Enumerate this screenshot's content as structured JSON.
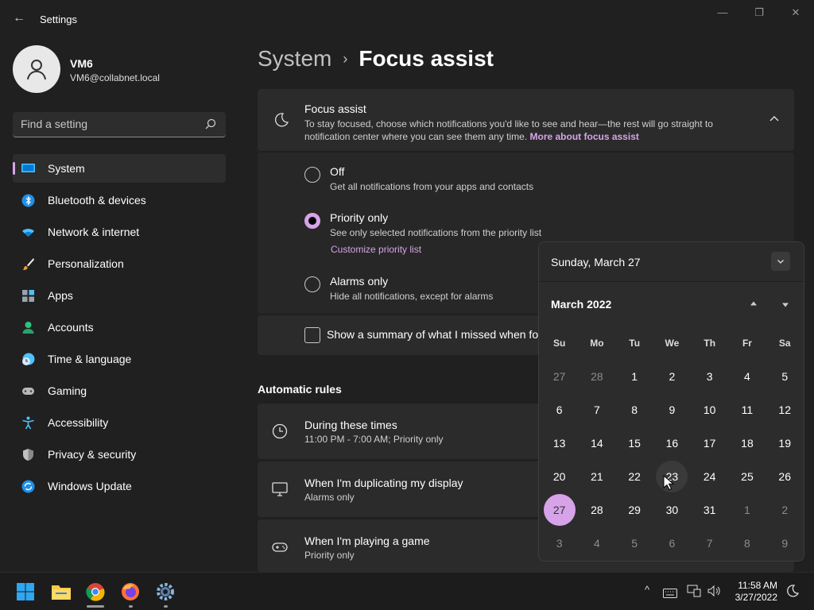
{
  "app": {
    "title": "Settings",
    "back_glyph": "←",
    "min_glyph": "—",
    "max_glyph": "❐",
    "close_glyph": "✕"
  },
  "user": {
    "name": "VM6",
    "email": "VM6@collabnet.local"
  },
  "search": {
    "placeholder": "Find a setting"
  },
  "nav": {
    "items": [
      {
        "label": "System",
        "icon": "monitor-icon",
        "active": true
      },
      {
        "label": "Bluetooth & devices",
        "icon": "bluetooth-icon"
      },
      {
        "label": "Network & internet",
        "icon": "wifi-icon"
      },
      {
        "label": "Personalization",
        "icon": "brush-icon"
      },
      {
        "label": "Apps",
        "icon": "apps-icon"
      },
      {
        "label": "Accounts",
        "icon": "person-icon"
      },
      {
        "label": "Time & language",
        "icon": "clock-globe-icon"
      },
      {
        "label": "Gaming",
        "icon": "gamepad-icon"
      },
      {
        "label": "Accessibility",
        "icon": "accessibility-icon"
      },
      {
        "label": "Privacy & security",
        "icon": "shield-icon"
      },
      {
        "label": "Windows Update",
        "icon": "update-icon"
      }
    ]
  },
  "breadcrumb": {
    "parent": "System",
    "separator": "›",
    "current": "Focus assist"
  },
  "focus_assist": {
    "title": "Focus assist",
    "description": "To stay focused, choose which notifications you'd like to see and hear—the rest will go straight to notification center where you can see them any time.",
    "link": "More about focus assist",
    "options": [
      {
        "label": "Off",
        "sub": "Get all notifications from your apps and contacts",
        "selected": false
      },
      {
        "label": "Priority only",
        "sub": "See only selected notifications from the priority list",
        "link": "Customize priority list",
        "selected": true
      },
      {
        "label": "Alarms only",
        "sub": "Hide all notifications, except for alarms",
        "selected": false
      }
    ],
    "summary_label": "Show a summary of what I missed when focus assist was on"
  },
  "automatic_rules": {
    "title": "Automatic rules",
    "rules": [
      {
        "title": "During these times",
        "sub": "11:00 PM - 7:00 AM; Priority only",
        "icon": "clock-icon"
      },
      {
        "title": "When I'm duplicating my display",
        "sub": "Alarms only",
        "icon": "display-icon"
      },
      {
        "title": "When I'm playing a game",
        "sub": "Priority only",
        "icon": "gamepad-icon"
      }
    ]
  },
  "calendar": {
    "header_date": "Sunday, March 27",
    "month_label": "March 2022",
    "days_of_week": [
      "Su",
      "Mo",
      "Tu",
      "We",
      "Th",
      "Fr",
      "Sa"
    ],
    "weeks": [
      [
        {
          "d": "27",
          "o": true
        },
        {
          "d": "28",
          "o": true
        },
        {
          "d": "1"
        },
        {
          "d": "2"
        },
        {
          "d": "3"
        },
        {
          "d": "4"
        },
        {
          "d": "5"
        }
      ],
      [
        {
          "d": "6"
        },
        {
          "d": "7"
        },
        {
          "d": "8"
        },
        {
          "d": "9"
        },
        {
          "d": "10"
        },
        {
          "d": "11"
        },
        {
          "d": "12"
        }
      ],
      [
        {
          "d": "13"
        },
        {
          "d": "14"
        },
        {
          "d": "15"
        },
        {
          "d": "16"
        },
        {
          "d": "17"
        },
        {
          "d": "18"
        },
        {
          "d": "19"
        }
      ],
      [
        {
          "d": "20"
        },
        {
          "d": "21"
        },
        {
          "d": "22"
        },
        {
          "d": "23",
          "hover": true
        },
        {
          "d": "24"
        },
        {
          "d": "25"
        },
        {
          "d": "26"
        }
      ],
      [
        {
          "d": "27",
          "sel": true
        },
        {
          "d": "28"
        },
        {
          "d": "29"
        },
        {
          "d": "30"
        },
        {
          "d": "31"
        },
        {
          "d": "1",
          "o": true
        },
        {
          "d": "2",
          "o": true
        }
      ],
      [
        {
          "d": "3",
          "o": true
        },
        {
          "d": "4",
          "o": true
        },
        {
          "d": "5",
          "o": true
        },
        {
          "d": "6",
          "o": true
        },
        {
          "d": "7",
          "o": true
        },
        {
          "d": "8",
          "o": true
        },
        {
          "d": "9",
          "o": true
        }
      ]
    ]
  },
  "taskbar": {
    "apps": [
      "windows-start-icon",
      "file-explorer-icon",
      "chrome-icon",
      "firefox-icon",
      "settings-gear-icon"
    ],
    "tray": {
      "chevron": "^",
      "time": "11:58 AM",
      "date": "3/27/2022"
    }
  },
  "colors": {
    "accent": "#d7a3e8",
    "background": "#202020",
    "card": "#2b2b2b"
  }
}
